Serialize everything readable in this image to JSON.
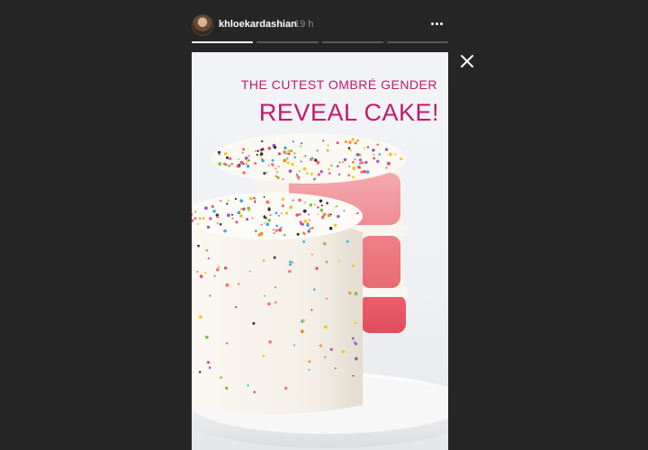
{
  "story": {
    "username": "khloekardashian",
    "timestamp": "19 h",
    "caption_line1": "THE CUTEST OMBRÉ GENDER",
    "caption_line2": "REVEAL CAKE!",
    "progress": [
      1.0,
      0.0,
      0.0,
      0.0
    ],
    "caption_color": "#c2186e"
  },
  "icons": {
    "more": "more-horizontal-icon",
    "close": "close-icon"
  }
}
